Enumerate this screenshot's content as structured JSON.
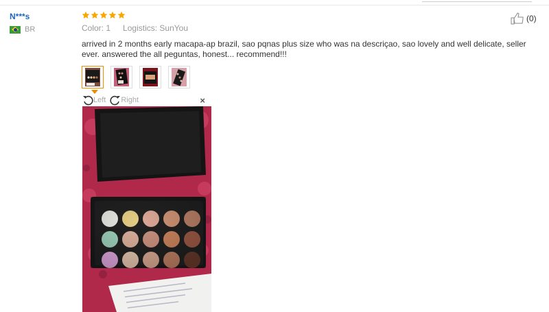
{
  "user": {
    "name": "N***s",
    "country": "BR"
  },
  "review": {
    "rating": 5,
    "color_label": "Color:",
    "color_value": "1",
    "logistics_label": "Logistics:",
    "logistics_value": "SunYou",
    "text": "arrived in 2 months early macapa-ap brazil, sao pqnas plus size who was na descriçao, sao lovely and well delicate, seller ever. answered the all peguntas, honest... recommend!!!",
    "thumbnail_count": 4
  },
  "viewer": {
    "rotate_left": "Left",
    "rotate_right": "Right",
    "close": "×"
  },
  "helpful": {
    "count": "(0)"
  },
  "colors": {
    "star": "#f7a700",
    "user_link": "#2266bb",
    "active_thumb": "#f08c00"
  }
}
